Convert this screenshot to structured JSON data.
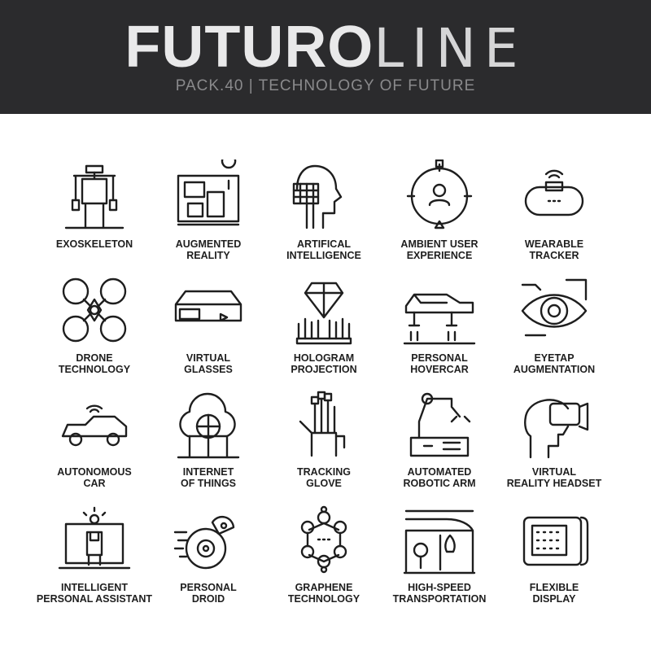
{
  "header": {
    "title_bold": "FUTURO",
    "title_light": "LINE",
    "subtitle": "PACK.40 | TECHNOLOGY OF FUTURE",
    "background_color": "#2b2b2d"
  },
  "icons": [
    {
      "icon": "exoskeleton-icon",
      "line1": "EXOSKELETON",
      "line2": ""
    },
    {
      "icon": "augmented-reality-icon",
      "line1": "AUGMENTED",
      "line2": "REALITY"
    },
    {
      "icon": "artificial-intelligence-icon",
      "line1": "ARTIFICAL",
      "line2": "INTELLIGENCE"
    },
    {
      "icon": "ambient-user-experience-icon",
      "line1": "AMBIENT USER",
      "line2": "EXPERIENCE"
    },
    {
      "icon": "wearable-tracker-icon",
      "line1": "WEARABLE",
      "line2": "TRACKER"
    },
    {
      "icon": "drone-icon",
      "line1": "DRONE",
      "line2": "TECHNOLOGY"
    },
    {
      "icon": "virtual-glasses-icon",
      "line1": "VIRTUAL",
      "line2": "GLASSES"
    },
    {
      "icon": "hologram-icon",
      "line1": "HOLOGRAM",
      "line2": "PROJECTION"
    },
    {
      "icon": "hovercar-icon",
      "line1": "PERSONAL",
      "line2": "HOVERCAR"
    },
    {
      "icon": "eye-icon",
      "line1": "EYETAP",
      "line2": "AUGMENTATION"
    },
    {
      "icon": "autonomous-car-icon",
      "line1": "AUTONOMOUS",
      "line2": "CAR"
    },
    {
      "icon": "cloud-globe-icon",
      "line1": "INTERNET",
      "line2": "OF THINGS"
    },
    {
      "icon": "tracking-glove-icon",
      "line1": "TRACKING",
      "line2": "GLOVE"
    },
    {
      "icon": "robotic-arm-icon",
      "line1": "AUTOMATED",
      "line2": "ROBOTIC ARM"
    },
    {
      "icon": "vr-headset-icon",
      "line1": "VIRTUAL",
      "line2": "REALITY HEADSET"
    },
    {
      "icon": "laptop-assistant-icon",
      "line1": "INTELLIGENT",
      "line2": "PERSONAL ASSISTANT"
    },
    {
      "icon": "droid-icon",
      "line1": "PERSONAL",
      "line2": "DROID"
    },
    {
      "icon": "graphene-icon",
      "line1": "GRAPHENE",
      "line2": "TECHNOLOGY"
    },
    {
      "icon": "train-icon",
      "line1": "HIGH-SPEED",
      "line2": "TRANSPORTATION"
    },
    {
      "icon": "flexible-display-icon",
      "line1": "FLEXIBLE",
      "line2": "DISPLAY"
    }
  ]
}
